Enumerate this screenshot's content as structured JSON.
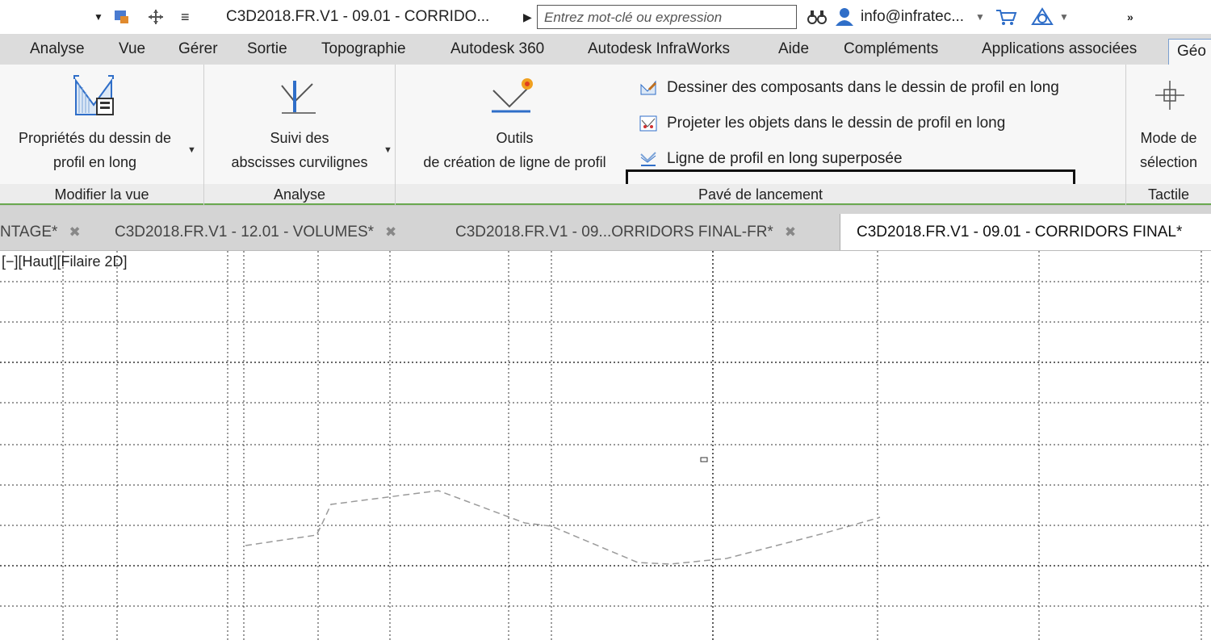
{
  "titlebar": {
    "doc_title": "C3D2018.FR.V1 - 09.01 - CORRIDO...",
    "search_placeholder": "Entrez mot-clé ou expression",
    "user": "info@infratec..."
  },
  "menubar": {
    "items": [
      "Analyse",
      "Vue",
      "Gérer",
      "Sortie",
      "Topographie",
      "Autodesk 360",
      "Autodesk InfraWorks",
      "Aide",
      "Compléments",
      "Applications associées",
      "Géo"
    ]
  },
  "ribbon": {
    "panels": [
      {
        "footer": "Modifier la vue",
        "big_button": {
          "line1": "Propriétés du dessin de",
          "line2": "profil en long"
        }
      },
      {
        "footer": "Analyse",
        "big_button": {
          "line1": "Suivi des",
          "line2": "abscisses curvilignes"
        }
      },
      {
        "footer": "Pavé de lancement",
        "big_button": {
          "line1": "Outils",
          "line2": "de création de ligne de profil"
        },
        "commands": [
          "Dessiner des composants dans le dessin de profil en long",
          "Projeter les objets dans le dessin de profil en long",
          "Ligne de profil en long superposée"
        ]
      },
      {
        "footer": "Tactile",
        "big_button": {
          "line1": "Mode de",
          "line2": "sélection"
        }
      }
    ]
  },
  "tabs": [
    {
      "label": "NTAGE*"
    },
    {
      "label": "C3D2018.FR.V1 - 12.01 - VOLUMES*"
    },
    {
      "label": "C3D2018.FR.V1 - 09...ORRIDORS FINAL-FR*"
    },
    {
      "label": "C3D2018.FR.V1 - 09.01 - CORRIDORS FINAL*",
      "active": true
    }
  ],
  "viewport": {
    "label": "[−][Haut][Filaire 2D]"
  },
  "colors": {
    "accent_green": "#6aa84f",
    "menubar_bg": "#dcdcdc",
    "tab_bg": "#d4d4d4",
    "profile_line": "#9a9a9a"
  }
}
